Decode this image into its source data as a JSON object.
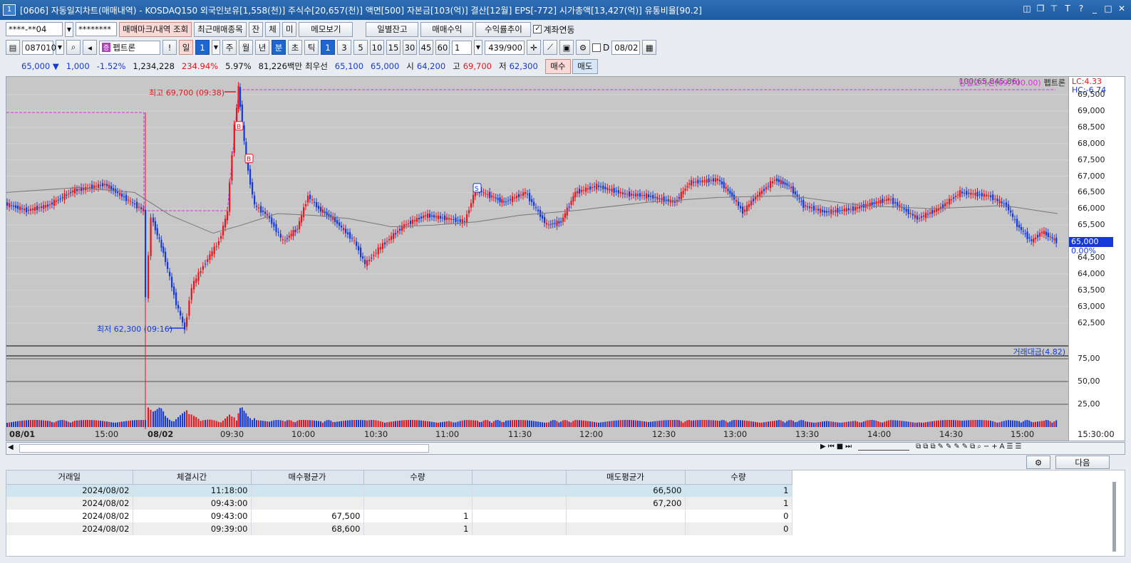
{
  "window": {
    "number": "1",
    "title": "[0606] 자동일지차트(매매내역) - KOSDAQ150 외국인보유[1,558(천)] 주식수[20,657(천)] 액면[500] 자본금[103(억)] 결산[12월] EPS[-772] 시가총액[13,427(억)] 유통비율[90.2]"
  },
  "toolbar1": {
    "account": "****-**04",
    "password": "********",
    "btn_mark": "매매마크/내역 조회",
    "btn_recent": "최근매매종목",
    "btn_jan": "잔",
    "btn_che": "체",
    "btn_mi": "미",
    "btn_memo": "메모보기",
    "btn_daily": "일별잔고",
    "btn_profit": "매매수익",
    "btn_rate": "수익률추이",
    "link_label": "계좌연동"
  },
  "toolbar2": {
    "code": "087010",
    "stock_name": "펩트론",
    "period_day": "일",
    "period_num": "1",
    "p_week": "주",
    "p_month": "월",
    "p_year": "년",
    "p_min": "분",
    "p_sec": "초",
    "p_tick": "틱",
    "intervals": [
      "1",
      "3",
      "5",
      "10",
      "15",
      "30",
      "45",
      "60"
    ],
    "interval_input": "1",
    "count": "439",
    "count_total": "/900",
    "date_prefix": "D",
    "date": "08/02"
  },
  "quote": {
    "price": "65,000",
    "arrow": "▼",
    "change": "1,000",
    "rate": "-1.52%",
    "volume": "1,234,228",
    "vol_rate": "234.94%",
    "turnover": "5.97%",
    "amount": "81,226백만",
    "best_label": "최우선",
    "best_ask": "65,100",
    "best_bid": "65,000",
    "open_label": "시",
    "open": "64,200",
    "high_label": "고",
    "high": "69,700",
    "low_label": "저",
    "low": "62,300",
    "buy": "매수",
    "sell": "매도"
  },
  "chart": {
    "top_ma": "100(65,845.86)",
    "upper_line": "당일고가선(69,700.00)",
    "stock_tag": "펩트론",
    "lc": "LC:4.33",
    "hc": "HC:-6.74",
    "high_note": "최고 69,700 (09:38)",
    "low_note": "최저 62,300 (09:16)",
    "price_tag": "65,000",
    "pct_tag": "0.00%",
    "vol_legend": "거래대금(4.82)",
    "y_labels": [
      "69,500",
      "69,000",
      "68,500",
      "68,000",
      "67,500",
      "67,000",
      "66,500",
      "66,000",
      "65,500",
      "65,000",
      "64,500",
      "64,000",
      "63,500",
      "63,000",
      "62,500"
    ],
    "vol_labels": [
      "75,00",
      "50,00",
      "25,00"
    ],
    "x_labels": [
      "08/01",
      "15:00",
      "08/02",
      "09:30",
      "10:00",
      "10:30",
      "11:00",
      "11:30",
      "12:00",
      "12:30",
      "13:00",
      "13:30",
      "14:00",
      "14:30",
      "15:00",
      "15:30:00"
    ],
    "markers": [
      "B",
      "B",
      "S"
    ],
    "colors": {
      "up": "#e8141c",
      "down": "#1539d8",
      "high_line": "#e030e0",
      "ma": "#777777"
    }
  },
  "grid": {
    "headers": [
      "거래일",
      "체결시간",
      "매수평균가",
      "수량",
      "",
      "매도평균가",
      "수량"
    ],
    "rows": [
      [
        "2024/08/02",
        "11:18:00",
        "",
        "",
        "",
        "66,500",
        "1"
      ],
      [
        "2024/08/02",
        "09:43:00",
        "",
        "",
        "",
        "67,200",
        "1"
      ],
      [
        "2024/08/02",
        "09:43:00",
        "67,500",
        "1",
        "",
        "",
        "0"
      ],
      [
        "2024/08/02",
        "09:39:00",
        "68,600",
        "1",
        "",
        "",
        "0"
      ]
    ],
    "next_btn": "다음"
  }
}
